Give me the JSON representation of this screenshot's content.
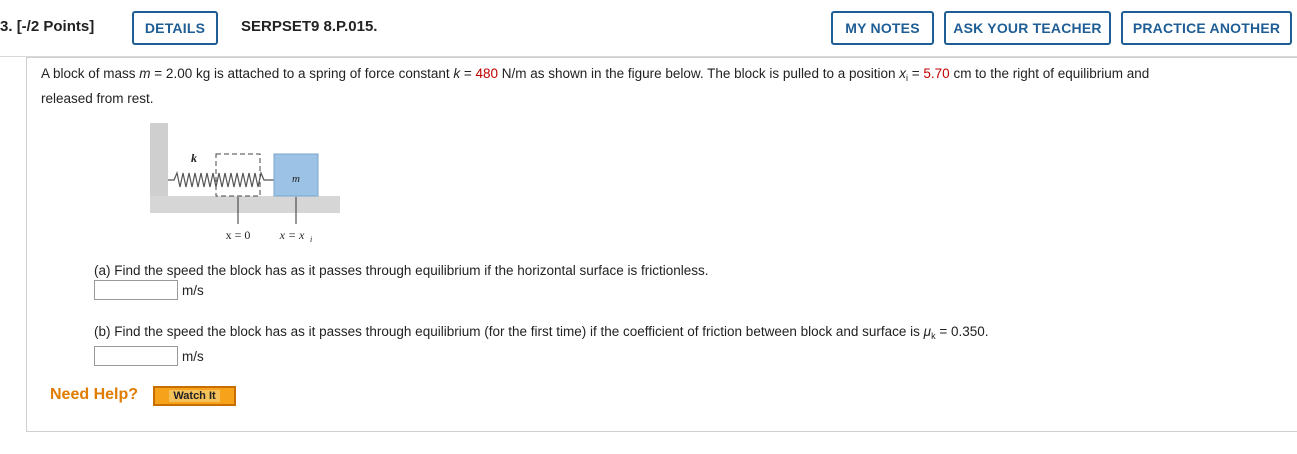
{
  "header": {
    "question_number": "3.",
    "points": "[-/2 Points]",
    "details_label": "DETAILS",
    "problem_code": "SERPSET9 8.P.015.",
    "my_notes_label": "MY NOTES",
    "ask_teacher_label": "ASK YOUR TEACHER",
    "practice_label": "PRACTICE ANOTHER"
  },
  "problem": {
    "intro_1": "A block of mass ",
    "mass_symbol": "m",
    "intro_2": " = 2.00 kg is attached to a spring of force constant ",
    "k_symbol": "k",
    "intro_3": " = ",
    "k_value": "480",
    "intro_4": " N/m as shown in the figure below. The block is pulled to a position ",
    "x_symbol": "x",
    "x_sub": "i",
    "intro_5": " = ",
    "x_value": "5.70",
    "intro_6": " cm to the right of equilibrium and",
    "intro_line2": "released from rest."
  },
  "figure": {
    "spring_label": "k",
    "block_label": "m",
    "eq_label": "x = 0",
    "xi_label": "x = x",
    "xi_sub": "i"
  },
  "part_a": {
    "question": "(a) Find the speed the block has as it passes through equilibrium if the horizontal surface is frictionless.",
    "input_value": "",
    "unit": "m/s"
  },
  "part_b": {
    "question_1": "(b) Find the speed the block has as it passes through equilibrium (for the first time) if the coefficient of friction between block and surface is ",
    "mu_symbol": "μ",
    "mu_sub": "k",
    "question_2": " = 0.350.",
    "input_value": "",
    "unit": "m/s"
  },
  "help": {
    "need_help_label": "Need Help?",
    "watch_label": "Watch It"
  },
  "colors": {
    "accent": "#1f5d95",
    "highlight": "#c00000",
    "help": "#e07c00",
    "watch_button": "#f7a21b"
  }
}
